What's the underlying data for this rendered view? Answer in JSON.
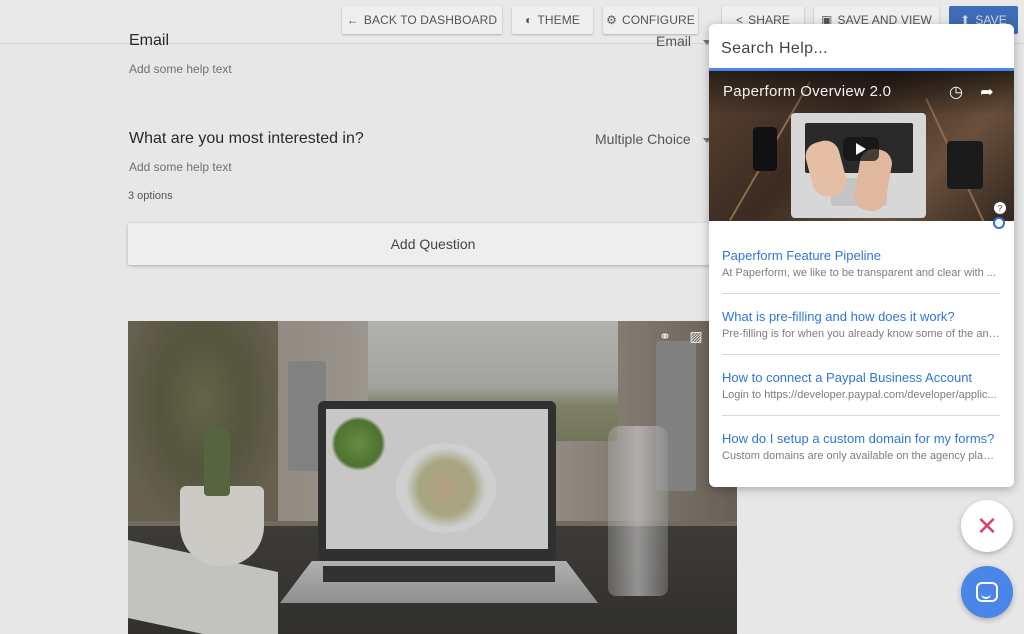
{
  "toolbar": {
    "buttons": [
      {
        "label": "BACK TO DASHBOARD",
        "icon": "arrow-left-icon"
      },
      {
        "label": "THEME",
        "icon": "droplet-icon"
      },
      {
        "label": "CONFIGURE",
        "icon": "gear-icon"
      },
      {
        "label": "SHARE",
        "icon": "share-icon"
      },
      {
        "label": "SAVE AND VIEW",
        "icon": "preview-icon"
      },
      {
        "label": "SAVE",
        "icon": "upload-icon"
      }
    ]
  },
  "form": {
    "questions": [
      {
        "title": "Email",
        "help": "Add some help text",
        "type": "Email"
      },
      {
        "title": "What are you most interested in?",
        "help": "Add some help text",
        "type": "Multiple Choice",
        "options_count": "3 options"
      }
    ],
    "add_question_label": "Add Question"
  },
  "help_panel": {
    "search_placeholder": "Search Help...",
    "video_title": "Paperform Overview 2.0",
    "articles": [
      {
        "title": "Paperform Feature Pipeline",
        "summary": "At Paperform, we like to be transparent and clear with ..."
      },
      {
        "title": "What is pre-filling and how does it work?",
        "summary": "Pre-filling is for when you already know some of the ans..."
      },
      {
        "title": "How to connect a Paypal Business Account",
        "summary": "Login to https://developer.paypal.com/developer/applic..."
      },
      {
        "title": "How do I setup a custom domain for my forms?",
        "summary": "Custom domains are only available on the agency plan. ..."
      }
    ]
  },
  "colors": {
    "accent": "#4a86e8",
    "link": "#2f76d9",
    "close": "#d6466a"
  }
}
